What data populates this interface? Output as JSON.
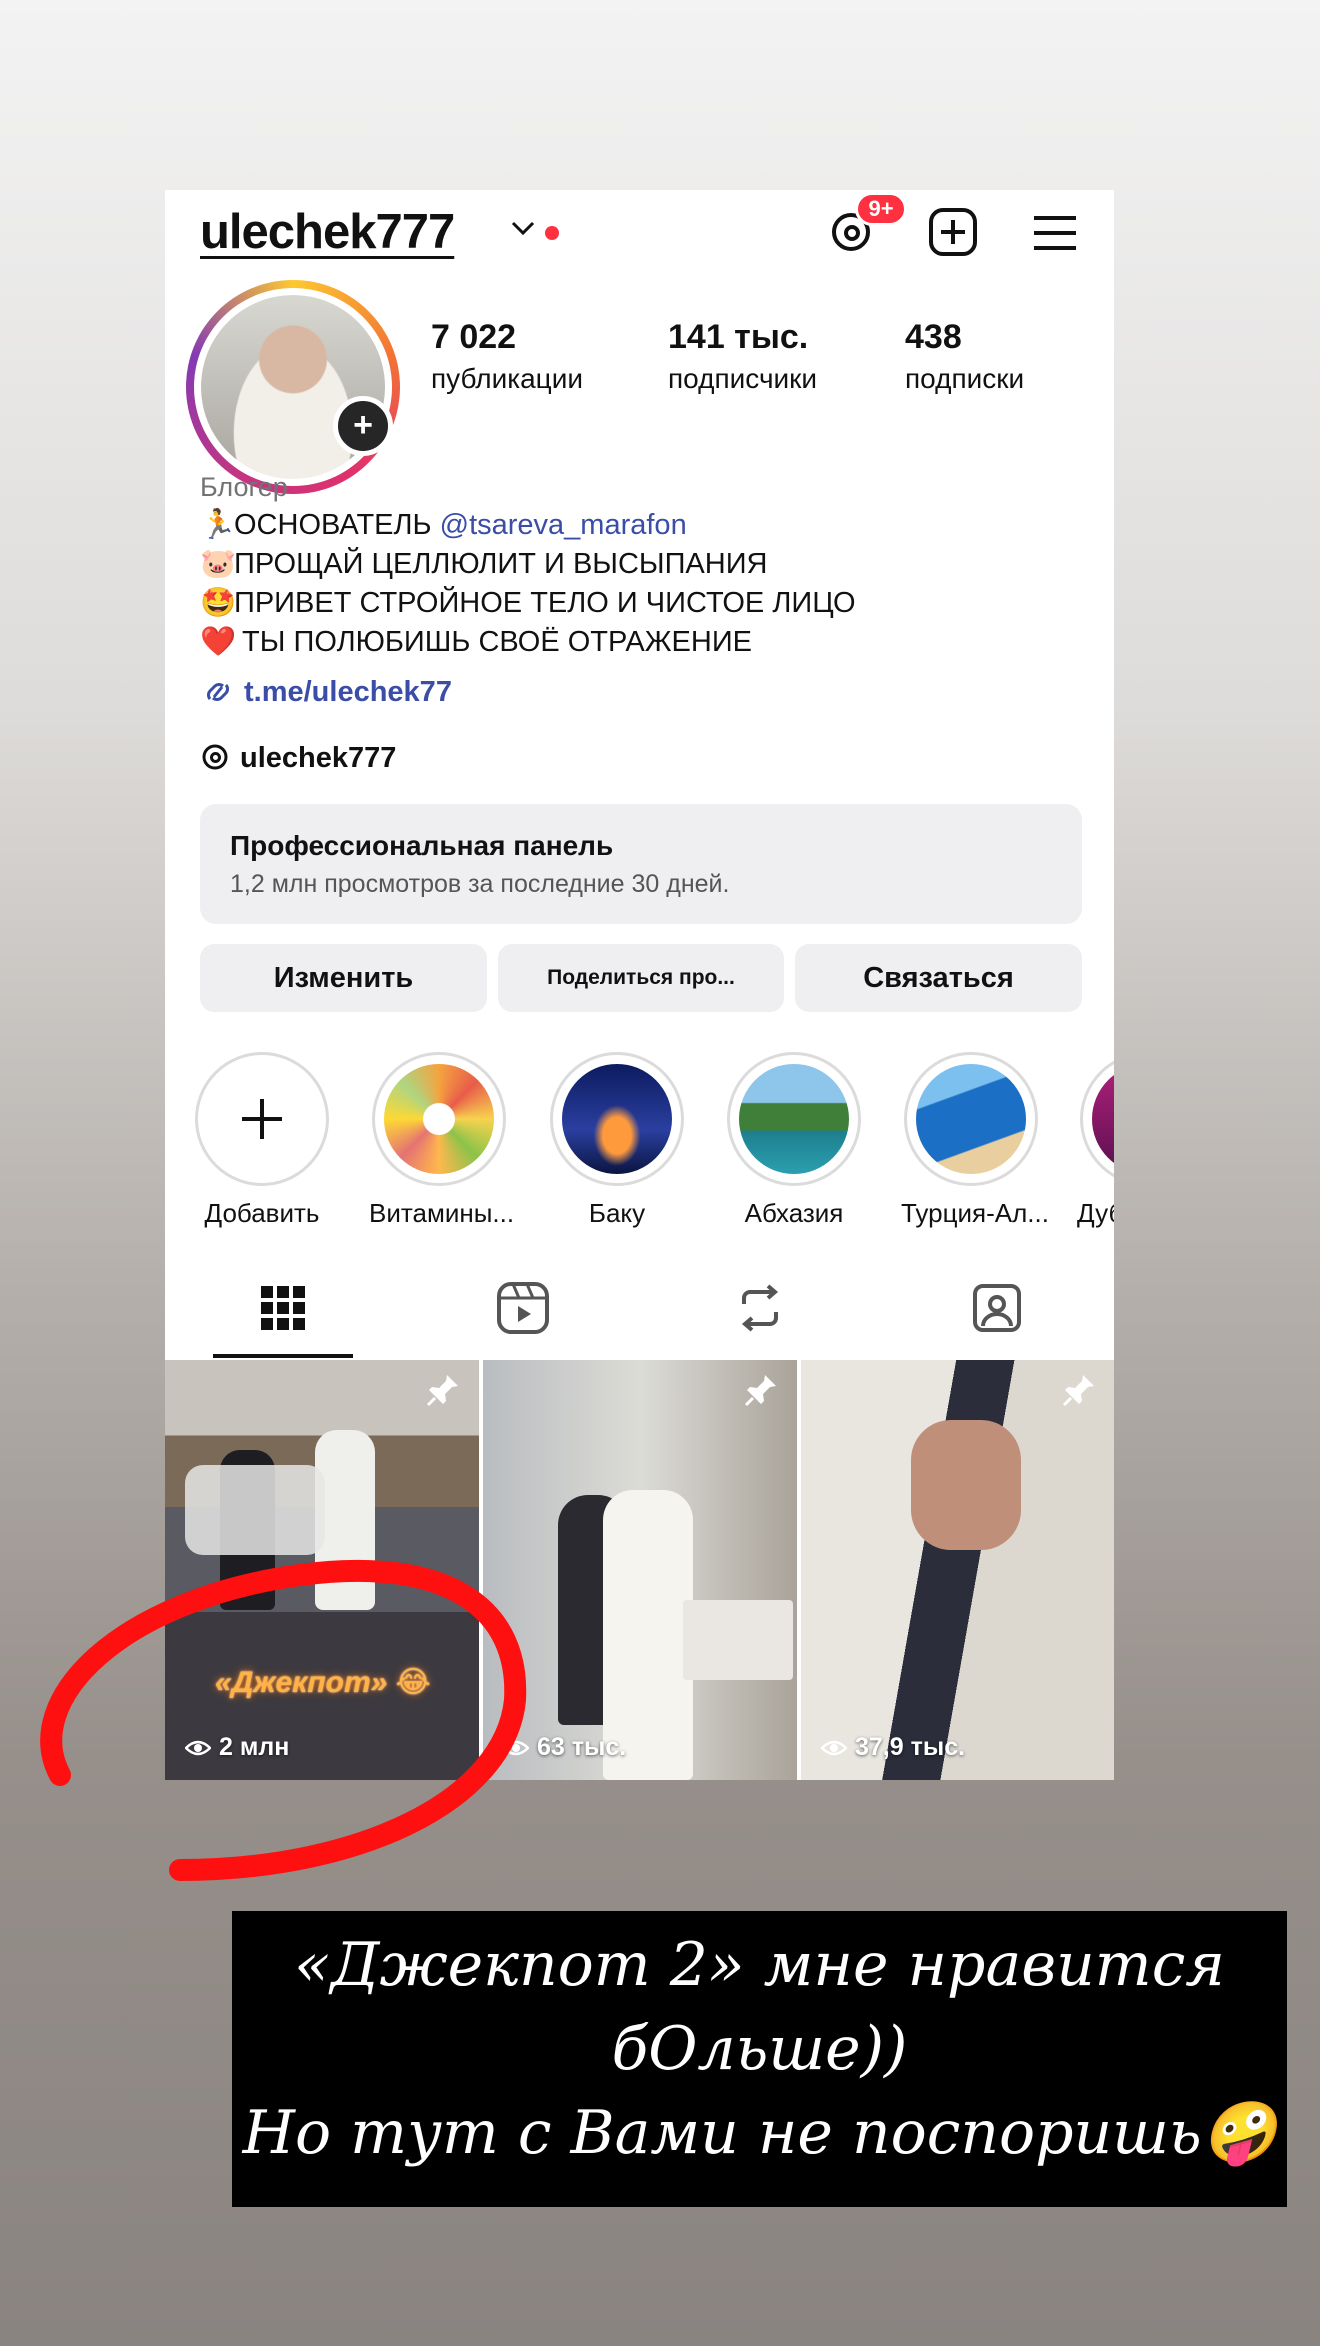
{
  "profile": {
    "username": "ulechek777",
    "threads_badge": "9+",
    "stats": [
      {
        "num": "7 022",
        "label": "публикации"
      },
      {
        "num": "141 тыс.",
        "label": "подписчики"
      },
      {
        "num": "438",
        "label": "подписки"
      }
    ],
    "category": "Блогер",
    "bio": [
      {
        "emoji": "🏃",
        "text": "ОСНОВАТЕЛЬ ",
        "mention": "@tsareva_marafon"
      },
      {
        "emoji": "🐷",
        "text": "ПРОЩАЙ ЦЕЛЛЮЛИТ И ВЫСЫПАНИЯ"
      },
      {
        "emoji": "🤩",
        "text": "ПРИВЕТ СТРОЙНОЕ ТЕЛО И ЧИСТОЕ ЛИЦО"
      },
      {
        "emoji": "❤️",
        "text": " ТЫ ПОЛЮБИШЬ СВОЁ ОТРАЖЕНИЕ"
      }
    ],
    "link": "t.me/ulechek77",
    "threads_handle": "ulechek777"
  },
  "pro_panel": {
    "title": "Профессиональная панель",
    "subtitle": "1,2 млн просмотров за последние 30 дней."
  },
  "buttons": {
    "edit": "Изменить",
    "share": "Поделиться про...",
    "contact": "Связаться"
  },
  "highlights": [
    {
      "label": "Добавить"
    },
    {
      "label": "Витамины..."
    },
    {
      "label": "Баку"
    },
    {
      "label": "Абхазия"
    },
    {
      "label": "Турция-Ал..."
    },
    {
      "label": "Дуб"
    }
  ],
  "posts": [
    {
      "views": "2 млн",
      "sticker": "«Джекпот» 😂",
      "pinned": true
    },
    {
      "views": "63 тыс.",
      "pinned": true
    },
    {
      "views": "37,9 тыс.",
      "pinned": true
    }
  ],
  "story_caption": {
    "line1": "«Джекпот 2» мне нравится",
    "line2": "бОльше))",
    "line3": "Но тут с Вами не поспоришь🤪"
  },
  "colors": {
    "accent_red": "#ff3040",
    "link_blue": "#3a4ea8",
    "annotation_red": "#ff1010"
  }
}
